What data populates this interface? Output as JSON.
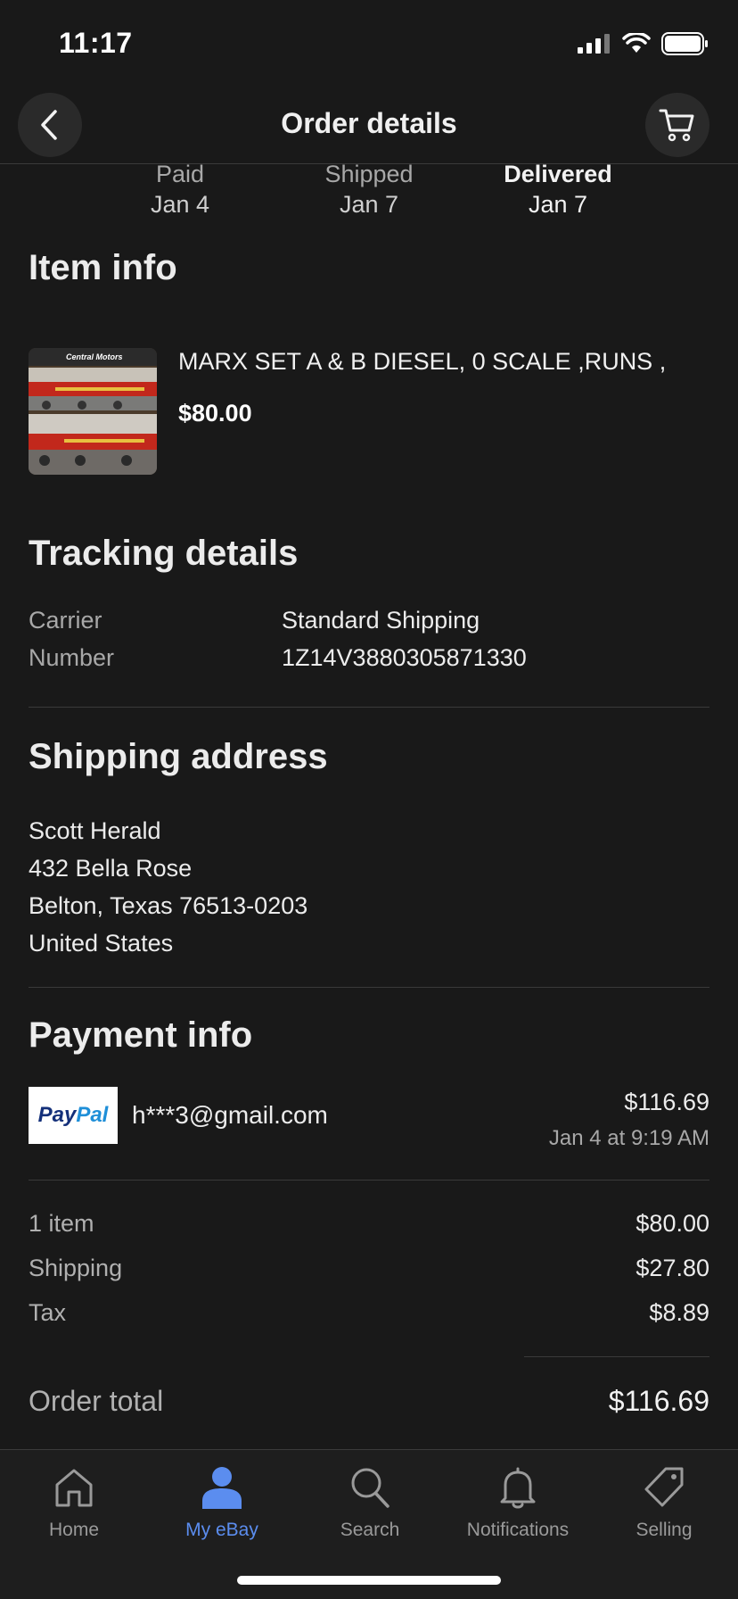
{
  "status_bar": {
    "time": "11:17"
  },
  "header": {
    "title": "Order details"
  },
  "steps": [
    {
      "label": "Paid",
      "date": "Jan 4",
      "active": false
    },
    {
      "label": "Shipped",
      "date": "Jan 7",
      "active": false
    },
    {
      "label": "Delivered",
      "date": "Jan 7",
      "active": true
    }
  ],
  "item_info": {
    "title": "Item info",
    "item_title": "MARX SET A & B DIESEL,  0 SCALE ,RUNS ,",
    "price": "$80.00"
  },
  "tracking": {
    "title": "Tracking details",
    "carrier_label": "Carrier",
    "carrier_value": "Standard Shipping",
    "number_label": "Number",
    "number_value": "1Z14V3880305871330"
  },
  "shipping_address": {
    "title": "Shipping address",
    "lines": [
      "Scott Herald",
      "432 Bella Rose",
      "Belton, Texas 76513-0203",
      "United States"
    ]
  },
  "payment": {
    "title": "Payment info",
    "logo_pay": "Pay",
    "logo_pal": "Pal",
    "email": "h***3@gmail.com",
    "amount": "$116.69",
    "date": "Jan 4 at 9:19 AM"
  },
  "summary": {
    "rows": [
      {
        "label": "1 item",
        "value": "$80.00"
      },
      {
        "label": "Shipping",
        "value": "$27.80"
      },
      {
        "label": "Tax",
        "value": "$8.89"
      }
    ],
    "total_label": "Order total",
    "total_value": "$116.69"
  },
  "tabbar": {
    "items": [
      {
        "label": "Home",
        "icon": "home-icon",
        "active": false
      },
      {
        "label": "My eBay",
        "icon": "person-icon",
        "active": true
      },
      {
        "label": "Search",
        "icon": "search-icon",
        "active": false
      },
      {
        "label": "Notifications",
        "icon": "bell-icon",
        "active": false
      },
      {
        "label": "Selling",
        "icon": "tag-icon",
        "active": false
      }
    ]
  },
  "colors": {
    "background": "#191919",
    "accent": "#5b8def",
    "muted": "#a8a8a8"
  }
}
